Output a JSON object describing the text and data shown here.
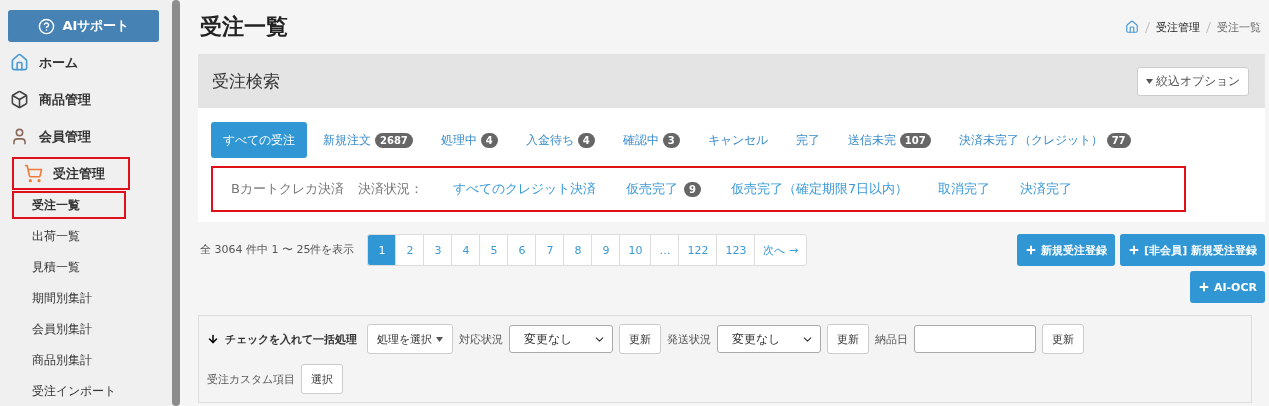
{
  "sidebar": {
    "support_button": "AIサポート",
    "items": [
      {
        "label": "ホーム",
        "highlighted": false
      },
      {
        "label": "商品管理",
        "highlighted": false
      },
      {
        "label": "会員管理",
        "highlighted": false
      },
      {
        "label": "受注管理",
        "highlighted": true,
        "children": [
          {
            "label": "受注一覧",
            "selected": true,
            "highlighted": true
          },
          {
            "label": "出荷一覧",
            "selected": false,
            "highlighted": false
          },
          {
            "label": "見積一覧",
            "selected": false,
            "highlighted": false
          },
          {
            "label": "期間別集計",
            "selected": false,
            "highlighted": false
          },
          {
            "label": "会員別集計",
            "selected": false,
            "highlighted": false
          },
          {
            "label": "商品別集計",
            "selected": false,
            "highlighted": false
          },
          {
            "label": "受注インポート",
            "selected": false,
            "highlighted": false
          }
        ]
      }
    ]
  },
  "page_title": "受注一覧",
  "breadcrumb": [
    "受注管理",
    "受注一覧"
  ],
  "search_panel": {
    "title": "受注検索",
    "options_button": "絞込オプション",
    "tabs": [
      {
        "label": "すべての受注",
        "selected": true
      },
      {
        "label": "新規注文",
        "count": "2687",
        "selected": false
      },
      {
        "label": "処理中",
        "count": "4",
        "selected": false
      },
      {
        "label": "入金待ち",
        "count": "4",
        "selected": false
      },
      {
        "label": "確認中",
        "count": "3",
        "selected": false
      },
      {
        "label": "キャンセル",
        "selected": false
      },
      {
        "label": "完了",
        "selected": false
      },
      {
        "label": "送信未完",
        "count": "107",
        "selected": false
      },
      {
        "label": "決済未完了（クレジット）",
        "count": "77",
        "selected": false
      }
    ],
    "credit_filter": {
      "highlighted": true,
      "label": "Bカートクレカ決済",
      "status_label": "決済状況：",
      "links": [
        {
          "label": "すべてのクレジット決済"
        },
        {
          "label": "仮売完了",
          "count": "9"
        },
        {
          "label": "仮売完了（確定期限7日以内）"
        },
        {
          "label": "取消完了"
        },
        {
          "label": "決済完了"
        }
      ]
    }
  },
  "summary": "全 3064 件中 1 〜 25件を表示",
  "pagination": [
    {
      "label": "1",
      "selected": true
    },
    {
      "label": "2",
      "selected": false
    },
    {
      "label": "3",
      "selected": false
    },
    {
      "label": "4",
      "selected": false
    },
    {
      "label": "5",
      "selected": false
    },
    {
      "label": "6",
      "selected": false
    },
    {
      "label": "7",
      "selected": false
    },
    {
      "label": "8",
      "selected": false
    },
    {
      "label": "9",
      "selected": false
    },
    {
      "label": "10",
      "selected": false
    },
    {
      "label": "…",
      "selected": false
    },
    {
      "label": "122",
      "selected": false
    },
    {
      "label": "123",
      "selected": false
    },
    {
      "label": "次へ →",
      "selected": false
    }
  ],
  "actions": [
    "新規受注登録",
    "[非会員] 新規受注登録",
    "AI-OCR"
  ],
  "bulk": {
    "title": "チェックを入れて一括処理",
    "process_button": "処理を選択",
    "fields": [
      {
        "kind": "select",
        "label": "対応状況",
        "value": "変更なし",
        "button": "更新"
      },
      {
        "kind": "select",
        "label": "発送状況",
        "value": "変更なし",
        "button": "更新"
      },
      {
        "kind": "date",
        "label": "納品日",
        "button": "更新"
      }
    ],
    "custom_label": "受注カスタム項目",
    "custom_button": "選択"
  }
}
